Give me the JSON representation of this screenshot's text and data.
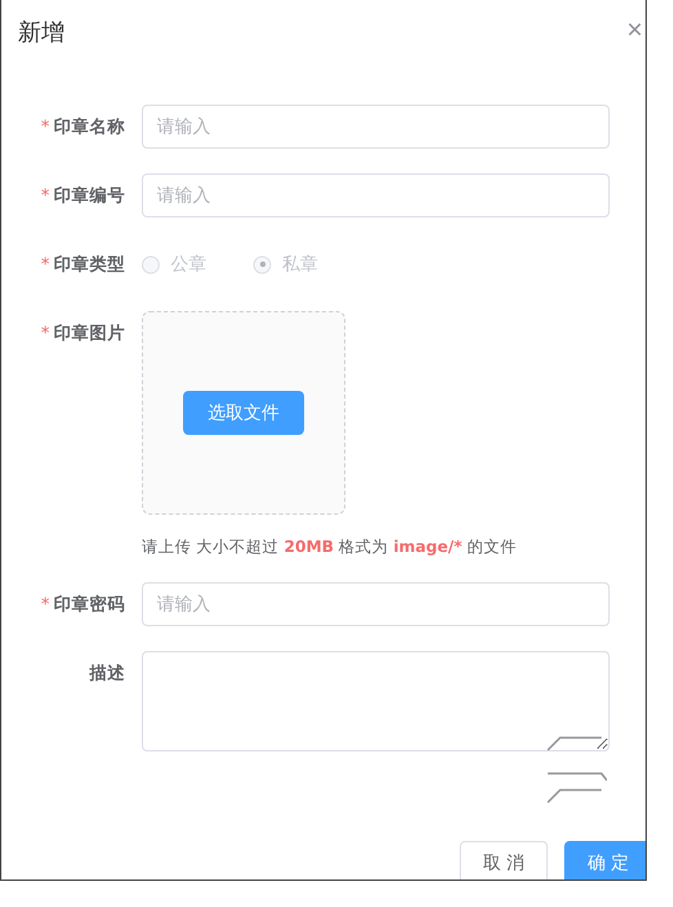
{
  "dialog": {
    "title": "新增",
    "close": "×"
  },
  "fields": [
    {
      "kind": "input",
      "label": "印章名称",
      "mark": "*",
      "placeholder": "请输入"
    },
    {
      "kind": "input",
      "label": "印章编号",
      "mark": "*",
      "placeholder": "请输入"
    },
    {
      "kind": "radio",
      "label": "印章类型",
      "mark": "*",
      "disabled": true,
      "options": [
        {
          "label": "公章",
          "selected": false
        },
        {
          "label": "私章",
          "selected": true
        }
      ]
    },
    {
      "kind": "upload",
      "label": "印章图片",
      "mark": "*",
      "button": "选取文件",
      "hint": [
        {
          "text": "请上传 大小不超过 ",
          "highlight": false
        },
        {
          "text": "20MB",
          "highlight": true
        },
        {
          "text": " 格式为 ",
          "highlight": false
        },
        {
          "text": "image/*",
          "highlight": true
        },
        {
          "text": " 的文件",
          "highlight": false
        }
      ]
    },
    {
      "kind": "input",
      "label": "印章密码",
      "mark": "*",
      "placeholder": "请输入"
    },
    {
      "kind": "textarea",
      "label": "描述"
    }
  ],
  "buttons": [
    {
      "label": "取 消",
      "kind": "default"
    },
    {
      "label": "确 定",
      "kind": "primary"
    }
  ]
}
